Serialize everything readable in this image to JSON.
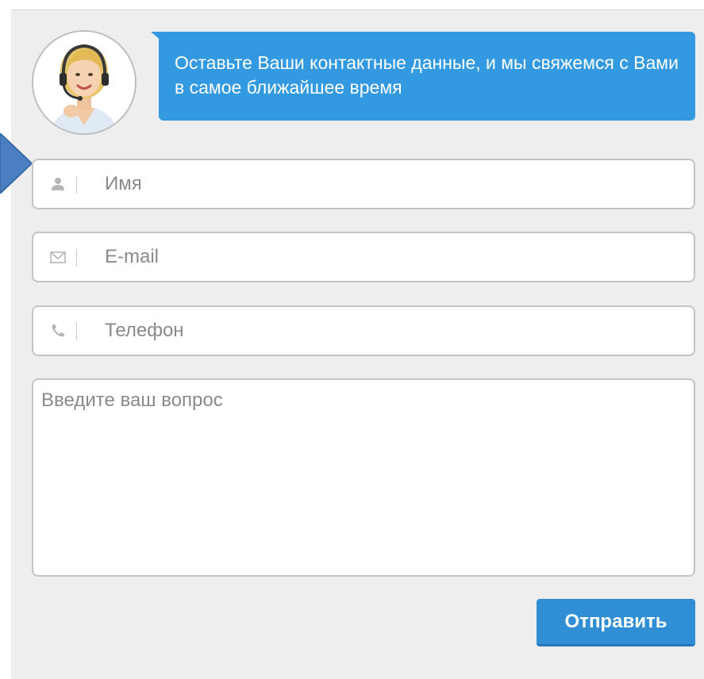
{
  "callout": {
    "message": "Оставьте Ваши контактные данные, и мы свяжемся с Вами в самое ближайшее время"
  },
  "form": {
    "name": {
      "placeholder": "Имя",
      "value": "",
      "icon": "user-icon"
    },
    "email": {
      "placeholder": "E-mail",
      "value": "",
      "icon": "envelope-icon"
    },
    "phone": {
      "placeholder": "Телефон",
      "value": "",
      "icon": "phone-icon"
    },
    "question": {
      "placeholder": "Введите ваш вопрос",
      "value": ""
    },
    "submit_label": "Отправить"
  },
  "colors": {
    "accent": "#3399e0",
    "button": "#2f8ed4",
    "panel_bg": "#eeeeee",
    "pointer": "#4a7fc1"
  }
}
